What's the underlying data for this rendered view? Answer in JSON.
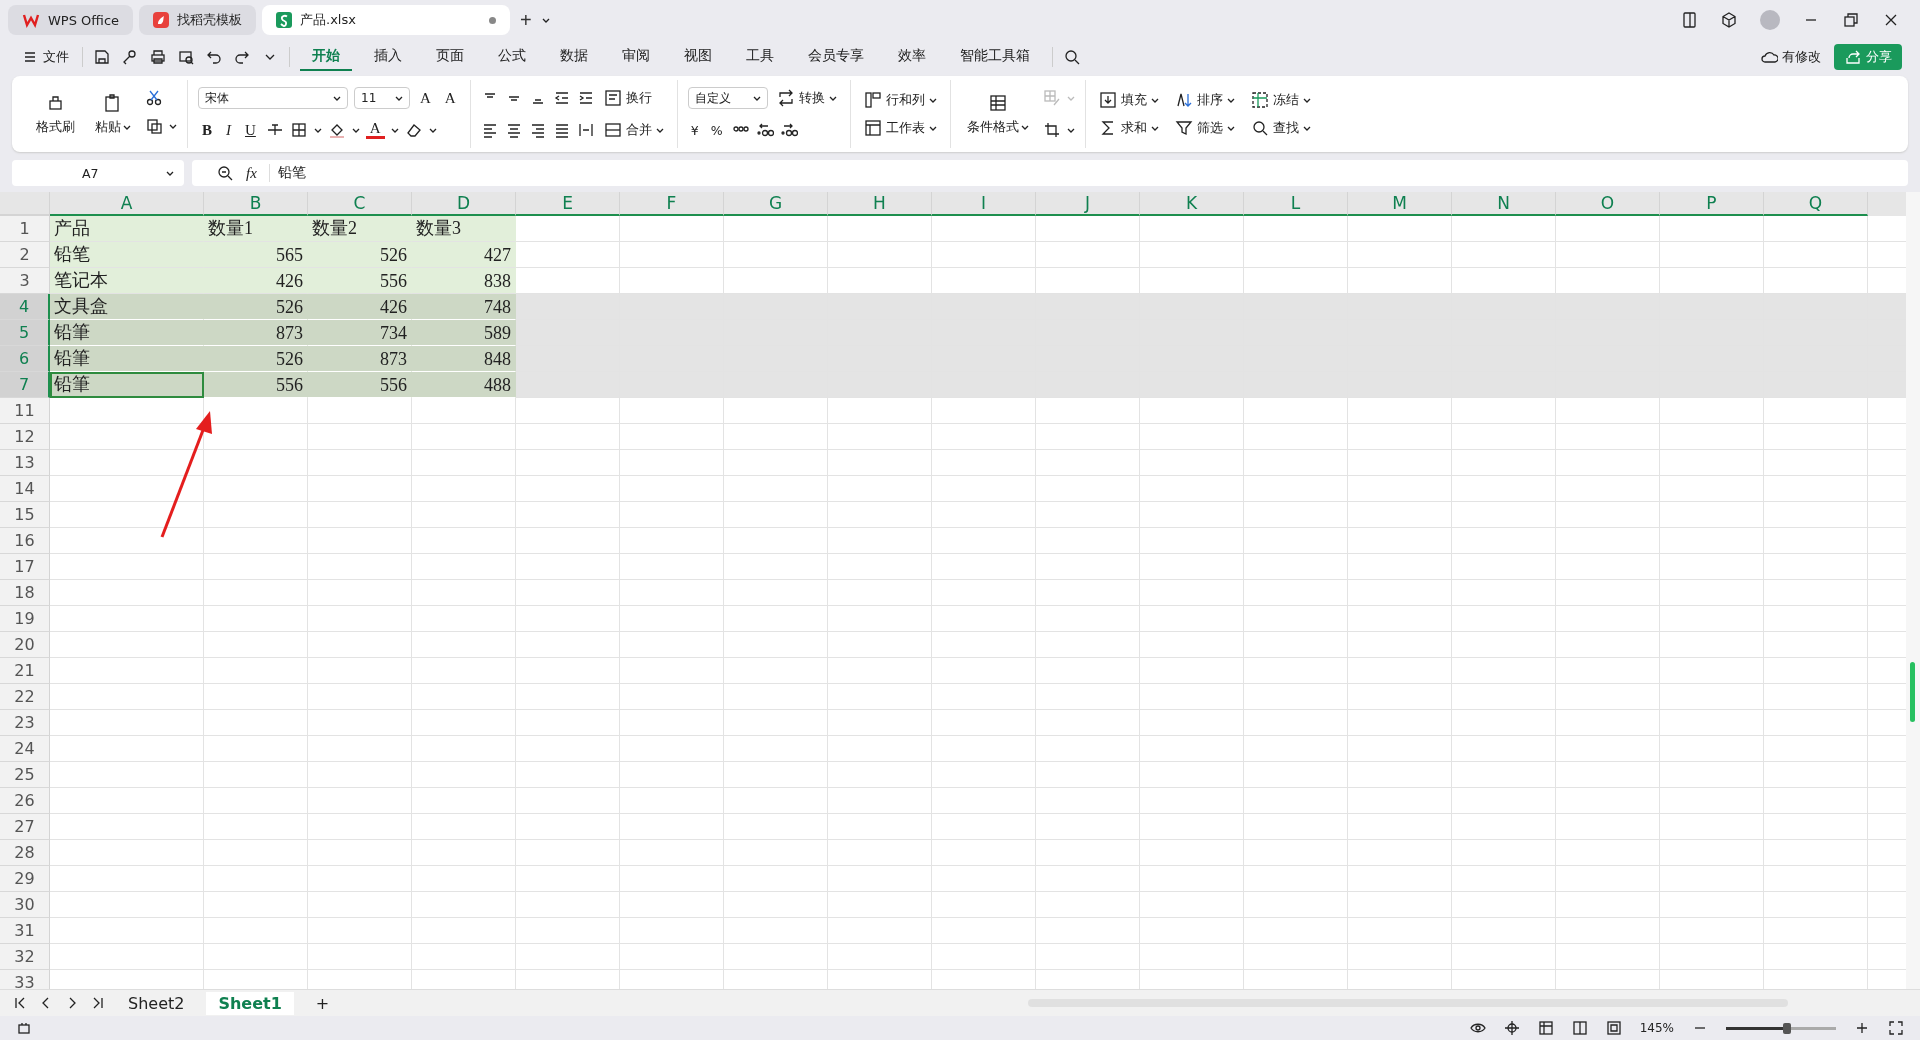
{
  "title_tabs": [
    {
      "kind": "wps",
      "label": "WPS Office",
      "selected": false
    },
    {
      "kind": "template",
      "label": "找稻壳模板",
      "selected": false
    },
    {
      "kind": "sheet",
      "label": "产品.xlsx",
      "selected": true
    }
  ],
  "new_tab": "+",
  "menu": {
    "file": "文件",
    "tabs": [
      {
        "label": "开始",
        "selected": true
      },
      {
        "label": "插入",
        "selected": false
      },
      {
        "label": "页面",
        "selected": false
      },
      {
        "label": "公式",
        "selected": false
      },
      {
        "label": "数据",
        "selected": false
      },
      {
        "label": "审阅",
        "selected": false
      },
      {
        "label": "视图",
        "selected": false
      },
      {
        "label": "工具",
        "selected": false
      },
      {
        "label": "会员专享",
        "selected": false
      },
      {
        "label": "效率",
        "selected": false
      },
      {
        "label": "智能工具箱",
        "selected": false
      }
    ]
  },
  "status_change": "有修改",
  "share": "分享",
  "ribbon": {
    "format_painter": "格式刷",
    "paste": "粘贴",
    "font": "宋体",
    "size": "11",
    "font_size_buttons": [
      "A",
      "A"
    ],
    "style_buttons": [
      "B",
      "I",
      "U"
    ],
    "font_color": "A",
    "wrap": "换行",
    "merge": "合并",
    "number_format": "自定义",
    "convert": "转换",
    "number_buttons": [
      "¥",
      "%"
    ],
    "rows_cols": "行和列",
    "worksheet": "工作表",
    "conditional": "条件格式",
    "tools": [
      {
        "kind": "fill",
        "label": "填充"
      },
      {
        "kind": "sort",
        "label": "排序"
      },
      {
        "kind": "freeze",
        "label": "冻结"
      },
      {
        "kind": "sum",
        "label": "求和"
      },
      {
        "kind": "filter",
        "label": "筛选"
      },
      {
        "kind": "find",
        "label": "查找"
      }
    ]
  },
  "formula_bar": {
    "name_box": "A7",
    "fx": "fx",
    "value": "铅笔"
  },
  "columns": [
    "A",
    "B",
    "C",
    "D",
    "E",
    "F",
    "G",
    "H",
    "I",
    "J",
    "K",
    "L",
    "M",
    "N",
    "O",
    "P",
    "Q"
  ],
  "rows": [
    {
      "header": "1",
      "selected": false,
      "kind": "header",
      "cells": [
        {
          "text": "产品",
          "active": false
        },
        {
          "text": "数量1",
          "active": false
        },
        {
          "text": "数量2",
          "active": false
        },
        {
          "text": "数量3",
          "active": false
        }
      ]
    },
    {
      "header": "2",
      "selected": false,
      "kind": "data",
      "cells": [
        {
          "text": "铅笔",
          "active": false
        },
        {
          "text": "565",
          "active": false
        },
        {
          "text": "526",
          "active": false
        },
        {
          "text": "427",
          "active": false
        }
      ]
    },
    {
      "header": "3",
      "selected": false,
      "kind": "data",
      "cells": [
        {
          "text": "笔记本",
          "active": false
        },
        {
          "text": "426",
          "active": false
        },
        {
          "text": "556",
          "active": false
        },
        {
          "text": "838",
          "active": false
        }
      ]
    },
    {
      "header": "4",
      "selected": true,
      "kind": "data",
      "cells": [
        {
          "text": "文具盒",
          "active": false
        },
        {
          "text": "526",
          "active": false
        },
        {
          "text": "426",
          "active": false
        },
        {
          "text": "748",
          "active": false
        }
      ]
    },
    {
      "header": "5",
      "selected": true,
      "kind": "data",
      "cells": [
        {
          "text": "铅筆",
          "active": false
        },
        {
          "text": "873",
          "active": false
        },
        {
          "text": "734",
          "active": false
        },
        {
          "text": "589",
          "active": false
        }
      ]
    },
    {
      "header": "6",
      "selected": true,
      "kind": "data",
      "cells": [
        {
          "text": "铅筆",
          "active": false
        },
        {
          "text": "526",
          "active": false
        },
        {
          "text": "873",
          "active": false
        },
        {
          "text": "848",
          "active": false
        }
      ]
    },
    {
      "header": "7",
      "selected": true,
      "kind": "data",
      "cells": [
        {
          "text": "铅筆",
          "active": true
        },
        {
          "text": "556",
          "active": false
        },
        {
          "text": "556",
          "active": false
        },
        {
          "text": "488",
          "active": false
        }
      ]
    },
    {
      "header": "11",
      "selected": false
    },
    {
      "header": "12",
      "selected": false
    },
    {
      "header": "13",
      "selected": false
    },
    {
      "header": "14",
      "selected": false
    },
    {
      "header": "15",
      "selected": false
    },
    {
      "header": "16",
      "selected": false
    },
    {
      "header": "17",
      "selected": false
    },
    {
      "header": "18",
      "selected": false
    },
    {
      "header": "19",
      "selected": false
    },
    {
      "header": "20",
      "selected": false
    },
    {
      "header": "21",
      "selected": false
    },
    {
      "header": "22",
      "selected": false
    },
    {
      "header": "23",
      "selected": false
    },
    {
      "header": "24",
      "selected": false
    },
    {
      "header": "25",
      "selected": false
    },
    {
      "header": "26",
      "selected": false
    },
    {
      "header": "27",
      "selected": false
    },
    {
      "header": "28",
      "selected": false
    },
    {
      "header": "29",
      "selected": false
    },
    {
      "header": "30",
      "selected": false
    },
    {
      "header": "31",
      "selected": false
    },
    {
      "header": "32",
      "selected": false
    },
    {
      "header": "33",
      "selected": false
    }
  ],
  "sheets": [
    {
      "label": "Sheet2",
      "selected": false
    },
    {
      "label": "Sheet1",
      "selected": true
    }
  ],
  "add_sheet": "+",
  "status_bar": {
    "zoom": "145%",
    "zoom_slider": {
      "level": 0.55
    }
  },
  "annotation": {
    "kind": "arrow"
  }
}
